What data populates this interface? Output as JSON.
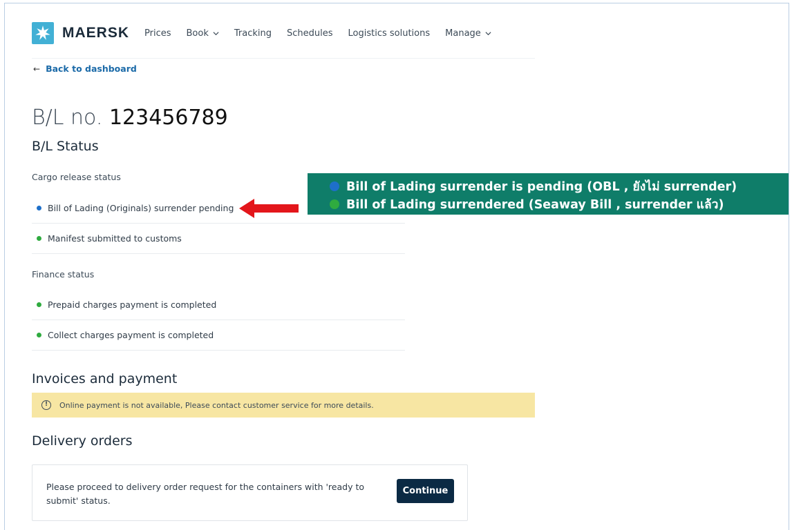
{
  "brand": {
    "name": "MAERSK",
    "logo_color": "#42b0d5"
  },
  "nav": {
    "items": [
      {
        "label": "Prices",
        "dropdown": false
      },
      {
        "label": "Book",
        "dropdown": true
      },
      {
        "label": "Tracking",
        "dropdown": false
      },
      {
        "label": "Schedules",
        "dropdown": false
      },
      {
        "label": "Logistics solutions",
        "dropdown": false
      },
      {
        "label": "Manage",
        "dropdown": true
      }
    ]
  },
  "back_link": {
    "arrow": "←",
    "label": "Back to dashboard"
  },
  "bl": {
    "prefix": "B/L no.",
    "number": "123456789"
  },
  "bl_status": {
    "title": "B/L Status",
    "cargo_label": "Cargo release status",
    "cargo_items": [
      {
        "text": "Bill of Lading (Originals) surrender pending",
        "color": "#1e6fc9"
      },
      {
        "text": "Manifest submitted to customs",
        "color": "#2fab3f"
      }
    ],
    "finance_label": "Finance status",
    "finance_items": [
      {
        "text": "Prepaid charges payment is completed",
        "color": "#2fab3f"
      },
      {
        "text": "Collect charges payment is completed",
        "color": "#2fab3f"
      }
    ]
  },
  "annotation": {
    "bg_color": "#0f7d69",
    "arrow_color": "#e3161b",
    "lines": [
      {
        "text": "Bill of Lading surrender is pending (OBL , ยังไม่ surrender)",
        "color": "#1e6fc9"
      },
      {
        "text": "Bill of Lading surrendered (Seaway Bill , surrender แล้ว)",
        "color": "#2fab3f"
      }
    ]
  },
  "invoices": {
    "title": "Invoices and payment",
    "alert_icon": "!",
    "alert_text": "Online payment is not available, Please contact customer service for more details."
  },
  "delivery": {
    "title": "Delivery orders",
    "text": "Please proceed to delivery order request for the containers with 'ready to submit' status.",
    "button": "Continue"
  }
}
